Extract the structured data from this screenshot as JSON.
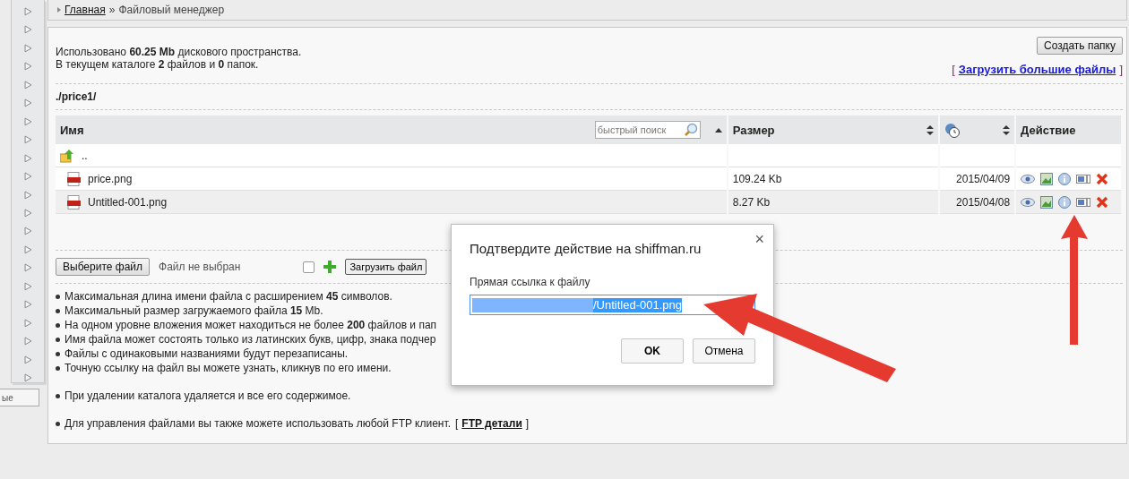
{
  "breadcrumb": {
    "home_link": "Главная",
    "separator": "»",
    "current": "Файловый менеджер"
  },
  "sidebar": {
    "tab_label": "ые"
  },
  "usage": {
    "line_1": "Использовано **60.25 Mb** дискового пространства.",
    "line_2": "В текущем каталоге **2** файлов и **0** папок."
  },
  "create_folder_button": "Создать папку",
  "upload_large": {
    "bracket_open": "[",
    "link": "Загрузить большие файлы",
    "bracket_close": "]"
  },
  "path": "./price1/",
  "table": {
    "columns": [
      {
        "kind": "name",
        "label": "Имя",
        "search_placeholder": "быстрый поиск",
        "sortable": true,
        "sorted": true
      },
      {
        "kind": "text",
        "label": "Размер",
        "sortable": true,
        "sorted": false
      },
      {
        "kind": "date",
        "sortable": true,
        "sorted": false
      },
      {
        "kind": "text",
        "label": "Действие",
        "sortable": false
      }
    ],
    "up_row": {
      "label": ".."
    },
    "rows": [
      {
        "name": "price.png",
        "size": "109.24 Kb",
        "date": "2015/04/09",
        "highlighted": false
      },
      {
        "name": "Untitled-001.png",
        "size": "8.27 Kb",
        "date": "2015/04/08",
        "highlighted": true
      }
    ]
  },
  "upload": {
    "choose_button": "Выберите файл",
    "file_status": "Файл не выбран",
    "checked": false,
    "upload_button": "Загрузить файл"
  },
  "notes": [
    [
      "Максимальная длина имени файла с расширением **45** символов.",
      "Максимальный размер загружаемого файла **15** Mb.",
      "На одном уровне вложения может находиться не более **200** файлов и пап",
      "Имя файла может состоять только из латинских букв, цифр, знака подчер",
      "Файлы с одинаковыми названиями будут перезаписаны.",
      "Точную ссылку на файл вы можете узнать, кликнув по его имени."
    ],
    [
      "При удалении каталога удаляется и все его содержимое."
    ],
    [
      "Для управления файлами вы также можете использовать любой FTP клиент."
    ]
  ],
  "ftp": {
    "bracket_open": "[",
    "link": "FTP детали",
    "bracket_close": "]"
  },
  "dialog": {
    "title": "Подтвердите действие на shiffman.ru",
    "close": "×",
    "label": "Прямая ссылка к файлу",
    "value": "/Untitled-001.png",
    "ok": "OK",
    "cancel": "Отмена"
  }
}
